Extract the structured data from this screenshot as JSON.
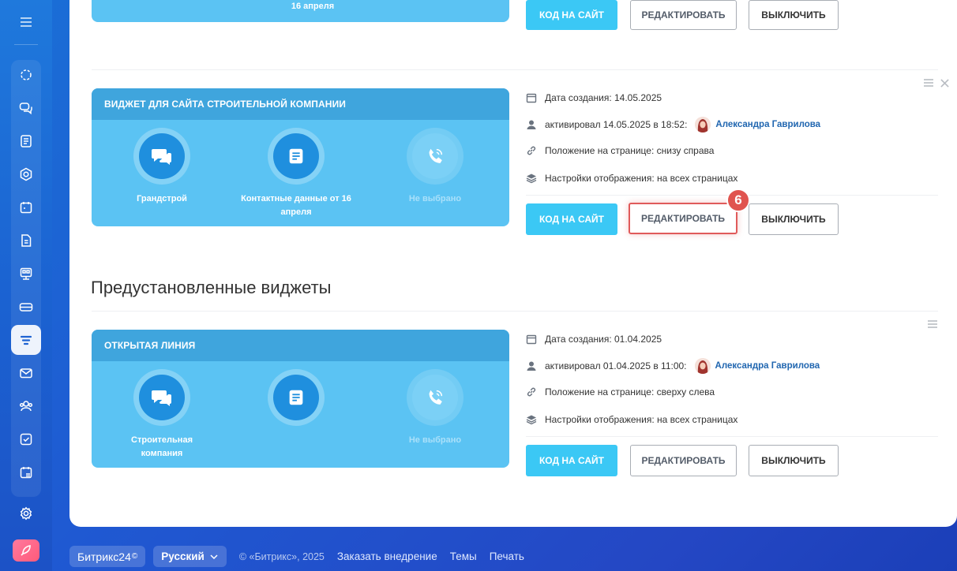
{
  "widgets": [
    {
      "header": "",
      "slot2_label": "16 апреля",
      "buttons": {
        "code": "КОД НА САЙТ",
        "edit": "РЕДАКТИРОВАТЬ",
        "off": "ВЫКЛЮЧИТЬ"
      }
    },
    {
      "header": "ВИДЖЕТ ДЛЯ САЙТА СТРОИТЕЛЬНОЙ КОМПАНИИ",
      "slots": [
        {
          "label": "Грандстрой",
          "icon": "chat-icon"
        },
        {
          "label": "Контактные данные от 16 апреля",
          "icon": "form-icon"
        },
        {
          "label": "Не выбрано",
          "icon": "phone-icon"
        }
      ],
      "meta": {
        "created_label": "Дата создания:",
        "created": "14.05.2025",
        "activated": "активировал 14.05.2025 в 18:52:",
        "user": "Александра Гаврилова",
        "position_label": "Положение на странице:",
        "position": "снизу справа",
        "display_label": "Настройки отображения:",
        "display": "на всех страницах"
      },
      "buttons": {
        "code": "КОД НА САЙТ",
        "edit": "РЕДАКТИРОВАТЬ",
        "off": "ВЫКЛЮЧИТЬ"
      },
      "step_badge": "6"
    },
    {
      "header": "ОТКРЫТАЯ ЛИНИЯ",
      "slots": [
        {
          "label": "Строительная компания",
          "icon": "chat-icon"
        },
        {
          "label": "",
          "icon": "form-icon"
        },
        {
          "label": "Не выбрано",
          "icon": "phone-icon"
        }
      ],
      "meta": {
        "created_label": "Дата создания:",
        "created": "01.04.2025",
        "activated": "активировал 01.04.2025 в 11:00:",
        "user": "Александра Гаврилова",
        "position_label": "Положение на странице:",
        "position": "сверху слева",
        "display_label": "Настройки отображения:",
        "display": "на всех страницах"
      },
      "buttons": {
        "code": "КОД НА САЙТ",
        "edit": "РЕДАКТИРОВАТЬ",
        "off": "ВЫКЛЮЧИТЬ"
      }
    }
  ],
  "section_title": "Предустановленные виджеты",
  "footer": {
    "brand": "Битрикс24",
    "brand_mark": "©",
    "language": "Русский",
    "copyright": "© «Битрикс», 2025",
    "links": [
      "Заказать внедрение",
      "Темы",
      "Печать"
    ]
  },
  "colors": {
    "accent": "#3bc8f5",
    "widget_bg": "#5bc3f3",
    "widget_header": "#3fa5dd",
    "highlight": "#e05a5a"
  }
}
